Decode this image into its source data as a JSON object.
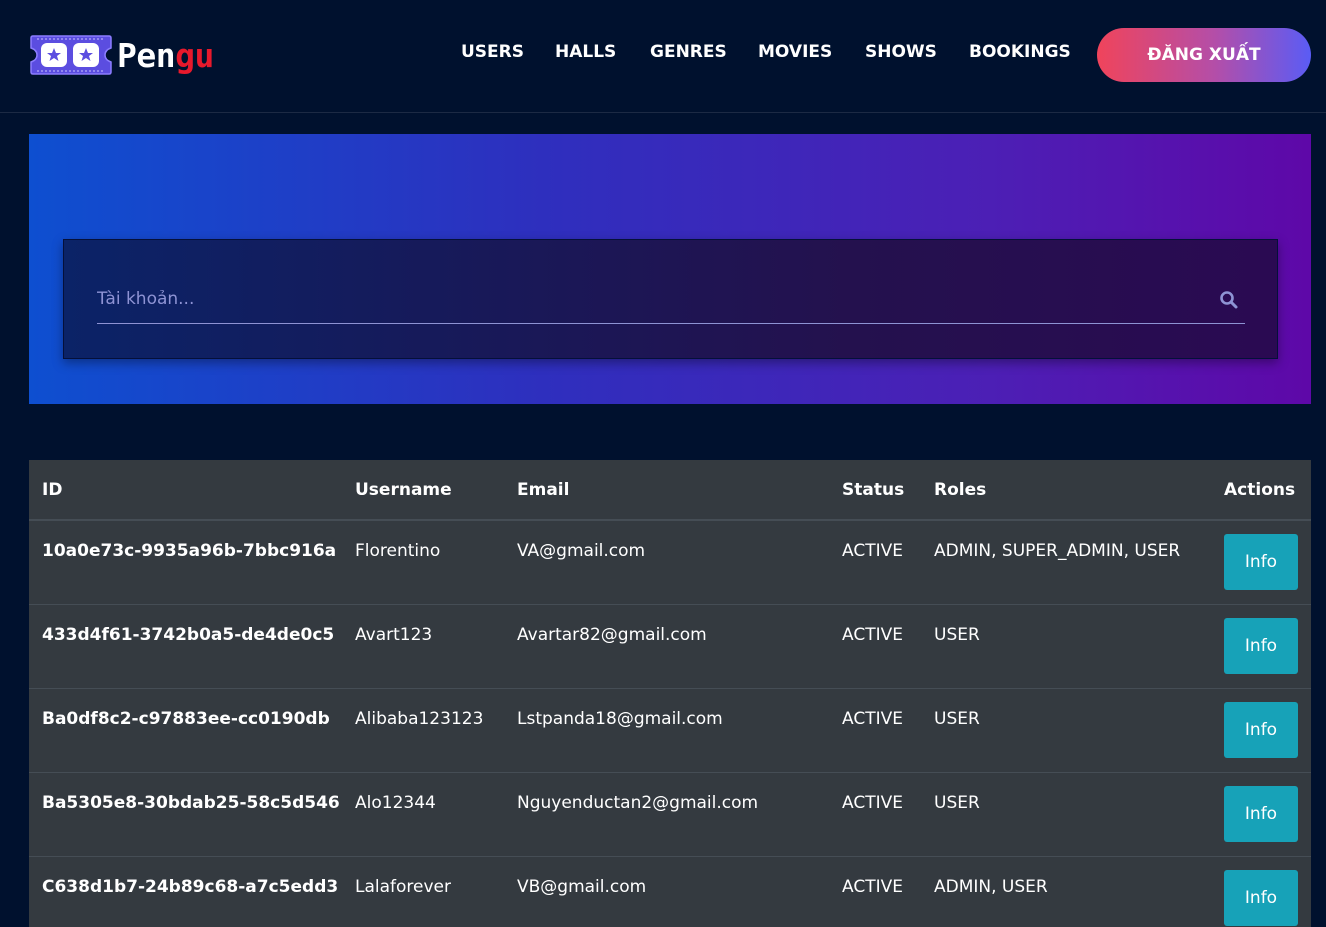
{
  "brand": {
    "name_part1": "Pen",
    "name_part2": "gu"
  },
  "nav": {
    "items": [
      "USERS",
      "HALLS",
      "GENRES",
      "MOVIES",
      "SHOWS",
      "BOOKINGS"
    ],
    "logout_label": "ĐĂNG XUẤT"
  },
  "search": {
    "placeholder": "Tài khoản..."
  },
  "table": {
    "headers": [
      "ID",
      "Username",
      "Email",
      "Status",
      "Roles",
      "Actions"
    ],
    "action_label": "Info",
    "rows": [
      {
        "id": "10a0e73c-9935a96b-7bbc916a",
        "username": "Florentino",
        "email": "VA@gmail.com",
        "status": "ACTIVE",
        "roles": "ADMIN, SUPER_ADMIN, USER"
      },
      {
        "id": "433d4f61-3742b0a5-de4de0c5",
        "username": "Avart123",
        "email": "Avartar82@gmail.com",
        "status": "ACTIVE",
        "roles": "USER"
      },
      {
        "id": "Ba0df8c2-c97883ee-cc0190db",
        "username": "Alibaba123123",
        "email": "Lstpanda18@gmail.com",
        "status": "ACTIVE",
        "roles": "USER"
      },
      {
        "id": "Ba5305e8-30bdab25-58c5d546",
        "username": "Alo12344",
        "email": "Nguyenductan2@gmail.com",
        "status": "ACTIVE",
        "roles": "USER"
      },
      {
        "id": "C638d1b7-24b89c68-a7c5edd3",
        "username": "Lalaforever",
        "email": "VB@gmail.com",
        "status": "ACTIVE",
        "roles": "ADMIN, USER"
      }
    ]
  },
  "colors": {
    "background": "#00112e",
    "accent": "#17a2b8",
    "brand_red": "#e8192c"
  }
}
